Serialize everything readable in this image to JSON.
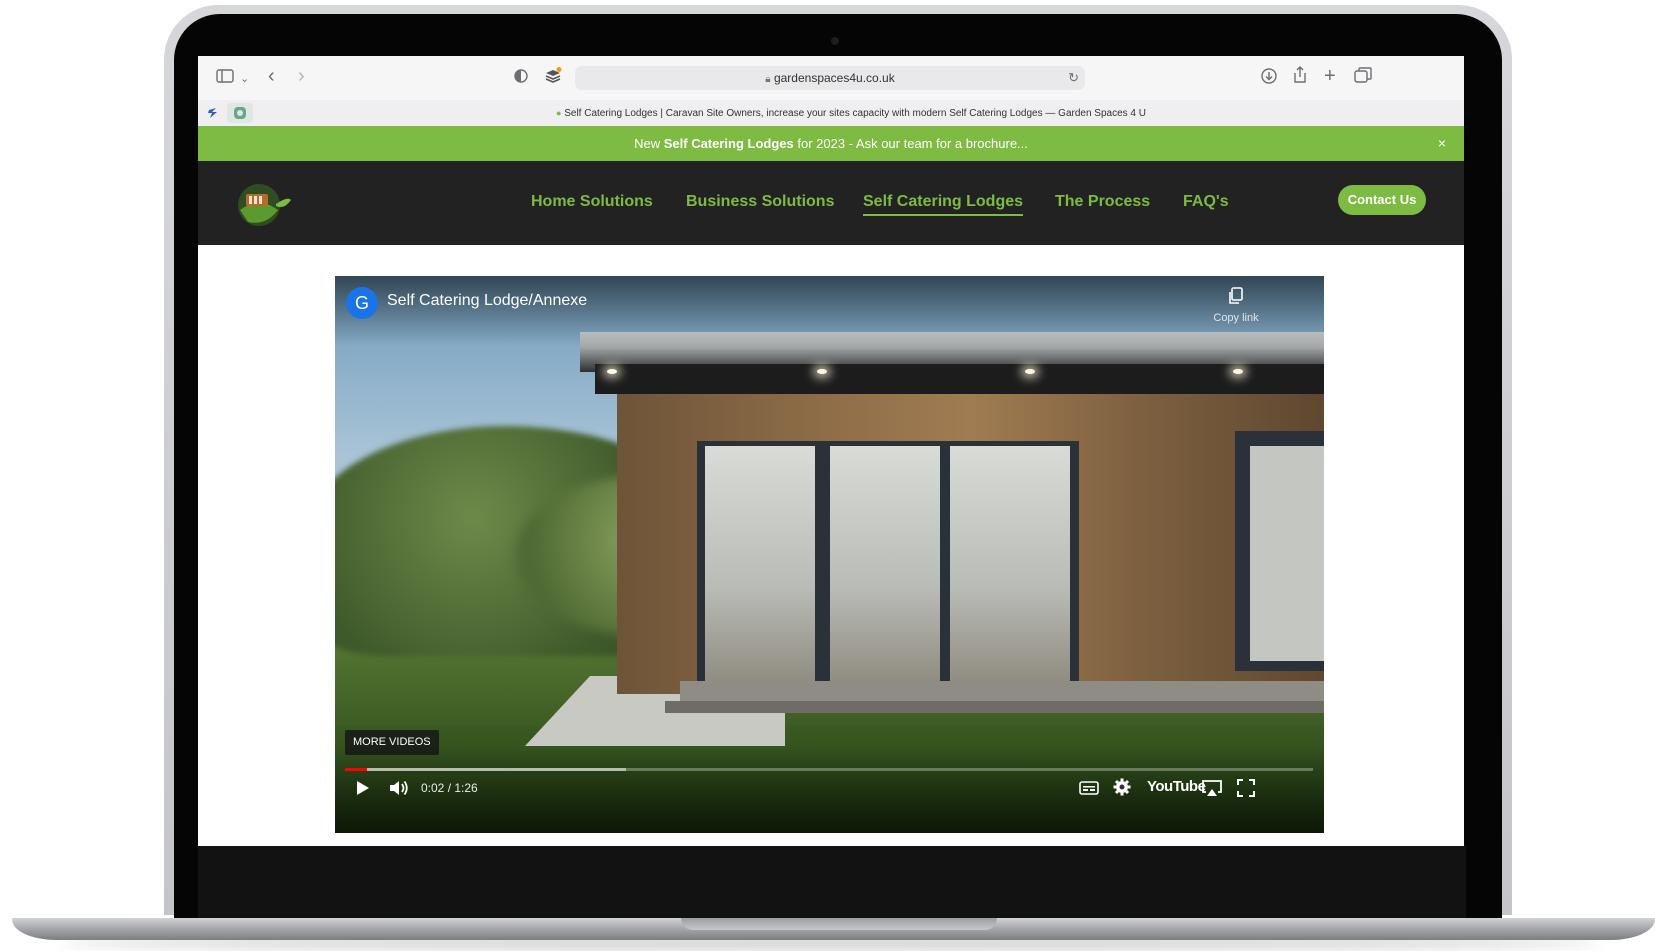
{
  "browser": {
    "url": "gardenspaces4u.co.uk",
    "tab_title": "Self Catering Lodges | Caravan Site Owners, increase your sites capacity with modern Self Catering Lodges — Garden Spaces 4 U"
  },
  "banner": {
    "prefix": "New ",
    "highlight": "Self Catering Lodges",
    "suffix": " for 2023 - Ask our team for a brochure...",
    "close": "×"
  },
  "nav": {
    "items": [
      {
        "label": "Home Solutions"
      },
      {
        "label": "Business Solutions"
      },
      {
        "label": "Self Catering Lodges",
        "active": true
      },
      {
        "label": "The Process"
      },
      {
        "label": "FAQ's"
      }
    ],
    "contact_label": "Contact Us"
  },
  "video": {
    "channel_initial": "G",
    "title": "Self Catering Lodge/Annexe",
    "copy_link_label": "Copy link",
    "more_videos_label": "MORE VIDEOS",
    "time": "0:02 / 1:26",
    "progress_played_fraction": 0.023,
    "progress_buffered_fraction": 0.29,
    "youtube_label": "YouTube"
  },
  "colors": {
    "brand_green": "#7dbb42",
    "header_bg": "#222222",
    "progress_red": "#ff0000"
  },
  "icons": [
    "sidebar-icon",
    "chevron-down-icon",
    "back-icon",
    "forward-icon",
    "privacy-shield-icon",
    "extension-icon",
    "lock-icon",
    "reload-icon",
    "download-icon",
    "share-icon",
    "new-tab-icon",
    "tab-overview-icon",
    "copy-icon",
    "play-icon",
    "volume-icon",
    "captions-icon",
    "settings-icon",
    "airplay-icon",
    "fullscreen-icon"
  ]
}
